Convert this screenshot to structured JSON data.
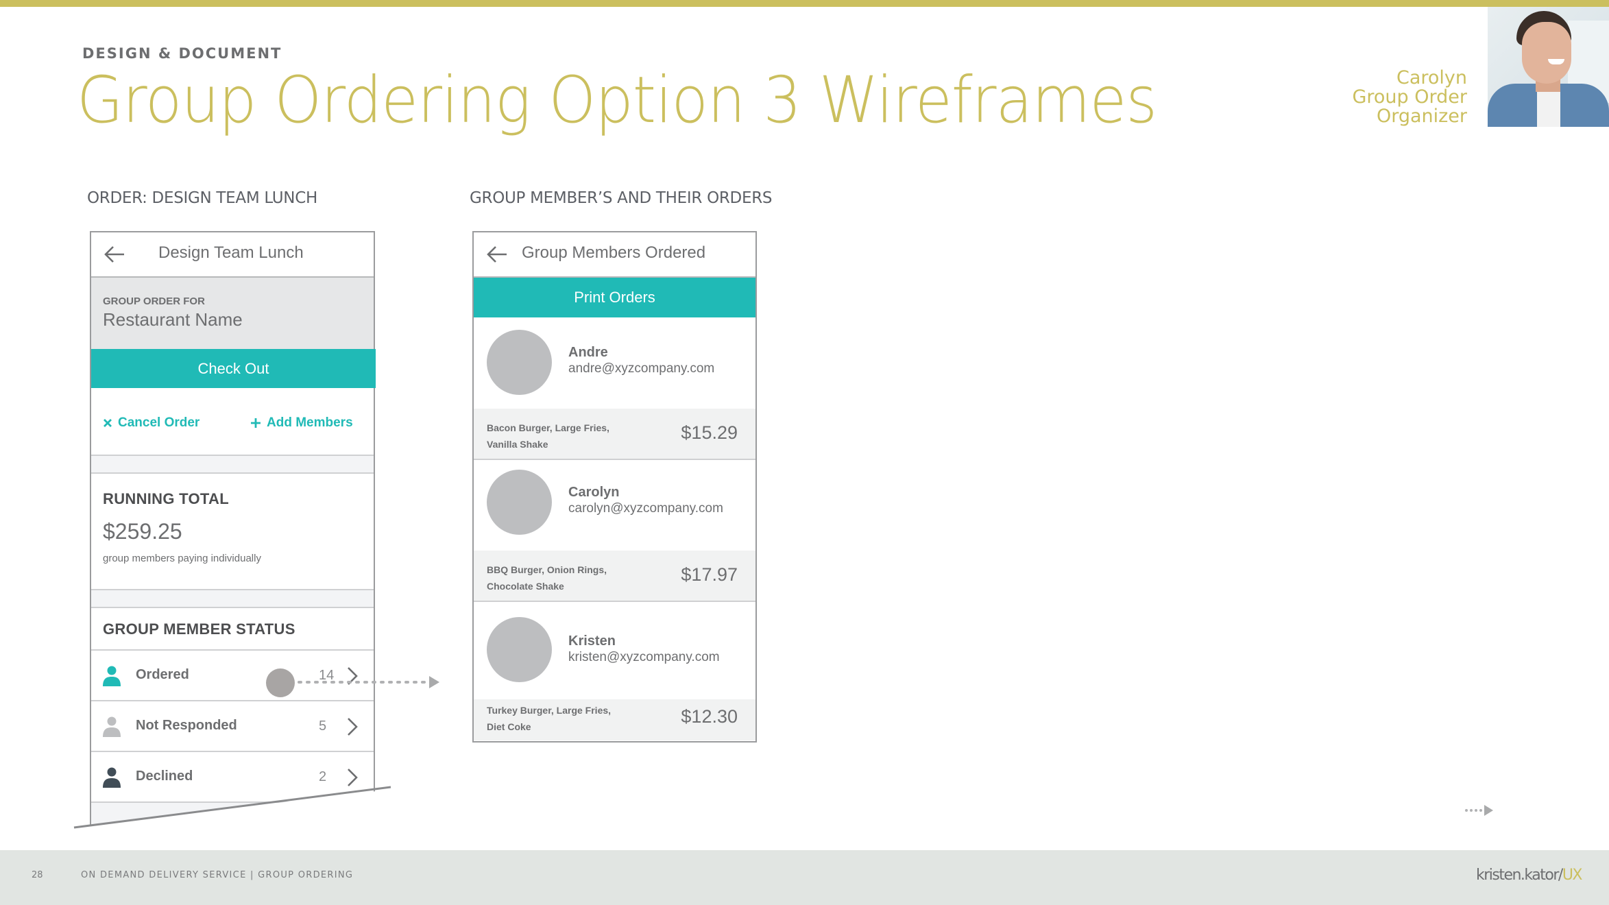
{
  "header": {
    "eyebrow": "DESIGN & DOCUMENT",
    "title": "Group Ordering Option 3 Wireframes",
    "persona": {
      "name": "Carolyn",
      "role_line1": "Group Order",
      "role_line2": "Organizer",
      "photo_icon": "persona-photo"
    }
  },
  "sections": {
    "left_label": "ORDER: DESIGN TEAM LUNCH",
    "right_label": "GROUP MEMBER’S AND THEIR ORDERS"
  },
  "order_screen": {
    "title": "Design Team Lunch",
    "back_icon": "arrow-left-icon",
    "group_order_for_label": "GROUP ORDER FOR",
    "restaurant_name": "Restaurant Name",
    "checkout_label": "Check Out",
    "cancel_label": "Cancel Order",
    "add_members_label": "Add Members",
    "running_total_heading": "RUNNING TOTAL",
    "running_total_value": "$259.25",
    "running_total_note": "group members paying individually",
    "status_heading": "GROUP MEMBER STATUS",
    "statuses": [
      {
        "label": "Ordered",
        "count": "14",
        "icon_color": "#20BAB6"
      },
      {
        "label": "Not Responded",
        "count": "5",
        "icon_color": "#bdbec0"
      },
      {
        "label": "Declined",
        "count": "2",
        "icon_color": "#414d57"
      }
    ]
  },
  "members_screen": {
    "title": "Group Members Ordered",
    "back_icon": "arrow-left-icon",
    "print_label": "Print Orders",
    "members": [
      {
        "name": "Andre",
        "email": "andre@xyzcompany.com",
        "items_line1": "Bacon Burger, Large Fries,",
        "items_line2": "Vanilla Shake",
        "price": "$15.29"
      },
      {
        "name": "Carolyn",
        "email": "carolyn@xyzcompany.com",
        "items_line1": "BBQ Burger, Onion Rings,",
        "items_line2": "Chocolate Shake",
        "price": "$17.97"
      },
      {
        "name": "Kristen",
        "email": "kristen@xyzcompany.com",
        "items_line1": "Turkey Burger, Large Fries,",
        "items_line2": "Diet Coke",
        "price": "$12.30"
      }
    ]
  },
  "footer": {
    "page_number": "28",
    "text": "ON DEMAND DELIVERY SERVICE | GROUP ORDERING",
    "brand_main": "kristen.kator/",
    "brand_accent": "UX"
  },
  "colors": {
    "accent_gold": "#CBBF5E",
    "teal": "#20BAB6",
    "footer_bg": "#E1E5E2"
  }
}
